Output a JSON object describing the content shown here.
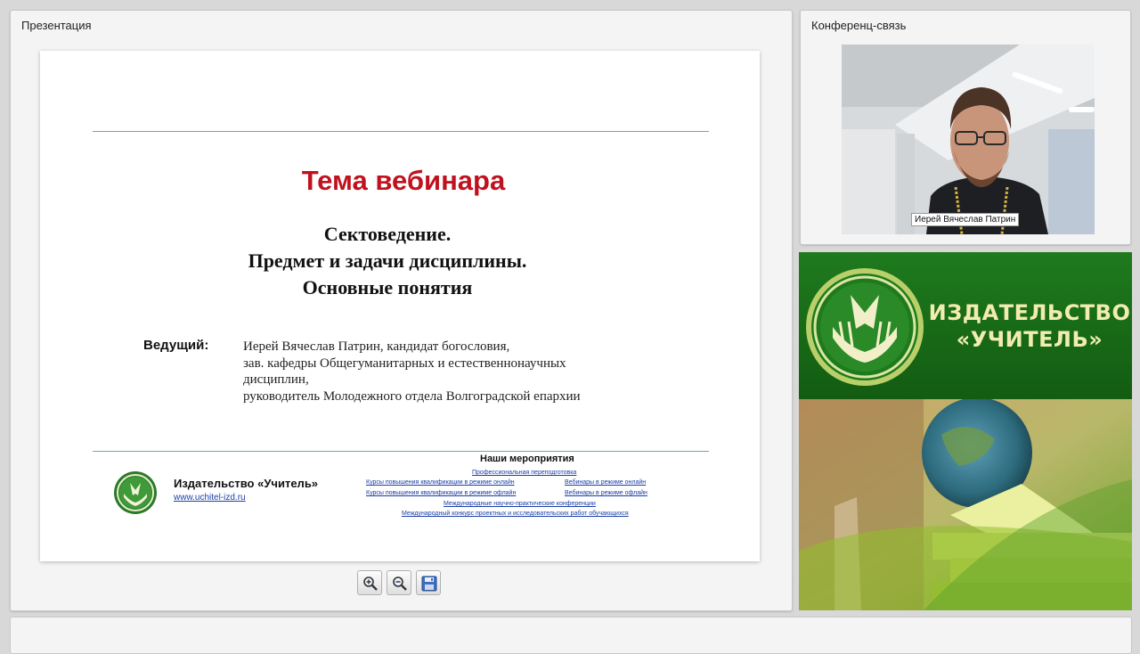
{
  "presentation": {
    "panel_title": "Презентация",
    "slide": {
      "heading": "Тема вебинара",
      "subtitle_lines": [
        "Сектоведение.",
        "Предмет и задачи дисциплины.",
        "Основные понятия"
      ],
      "host_label": "Ведущий:",
      "host_lines": [
        "Иерей Вячеслав Патрин, кандидат богословия,",
        "зав. кафедры Общегуманитарных и естественнонаучных",
        "дисциплин,",
        "руководитель Молодежного отдела Волгоградской епархии"
      ],
      "publisher_name": "Издательство «Учитель»",
      "publisher_url": "www.uchitel-izd.ru",
      "events_title": "Наши мероприятия",
      "events": [
        "Профессиональная переподготовка",
        "Курсы повышения квалификации в режиме онлайн",
        "Вебинары в режиме онлайн",
        "Курсы повышения квалификации в режиме офлайн",
        "Вебинары в режиме офлайн",
        "Международные научно-практические конференции",
        "Международный конкурс проектных и исследовательских работ обучающихся"
      ],
      "heading_color": "#c0121e"
    },
    "toolbar": {
      "zoom_in_icon": "zoom-in-icon",
      "zoom_out_icon": "zoom-out-icon",
      "save_icon": "floppy-disk-icon"
    }
  },
  "conference": {
    "panel_title": "Конференц-связь",
    "speaker_name": "Иерей Вячеслав Патрин"
  },
  "banner": {
    "line1": "ИЗДАТЕЛЬСТВО",
    "line2": "«УЧИТЕЛЬ»",
    "brand_green": "#176816",
    "brand_text_color": "#f2ecb0"
  }
}
